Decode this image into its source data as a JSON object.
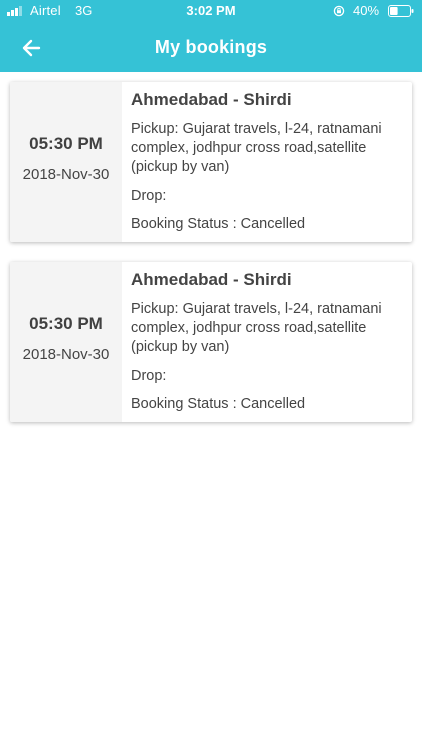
{
  "status_bar": {
    "carrier": "Airtel",
    "network": "3G",
    "time": "3:02 PM",
    "battery": "40%",
    "battery_level": 0.4
  },
  "header": {
    "title": "My bookings",
    "back_icon": "arrow-left-icon",
    "background": "#35c2d6"
  },
  "bookings": [
    {
      "time": "05:30 PM",
      "date": "2018-Nov-30",
      "route": "Ahmedabad - Shirdi",
      "pickup": "Pickup: Gujarat travels, l-24, ratnamani complex, jodhpur cross road,satellite (pickup by van)",
      "drop": "Drop:",
      "status": "Booking Status : Cancelled"
    },
    {
      "time": "05:30 PM",
      "date": "2018-Nov-30",
      "route": "Ahmedabad - Shirdi",
      "pickup": "Pickup: Gujarat travels, l-24, ratnamani complex, jodhpur cross road,satellite (pickup by van)",
      "drop": "Drop:",
      "status": "Booking Status : Cancelled"
    }
  ]
}
